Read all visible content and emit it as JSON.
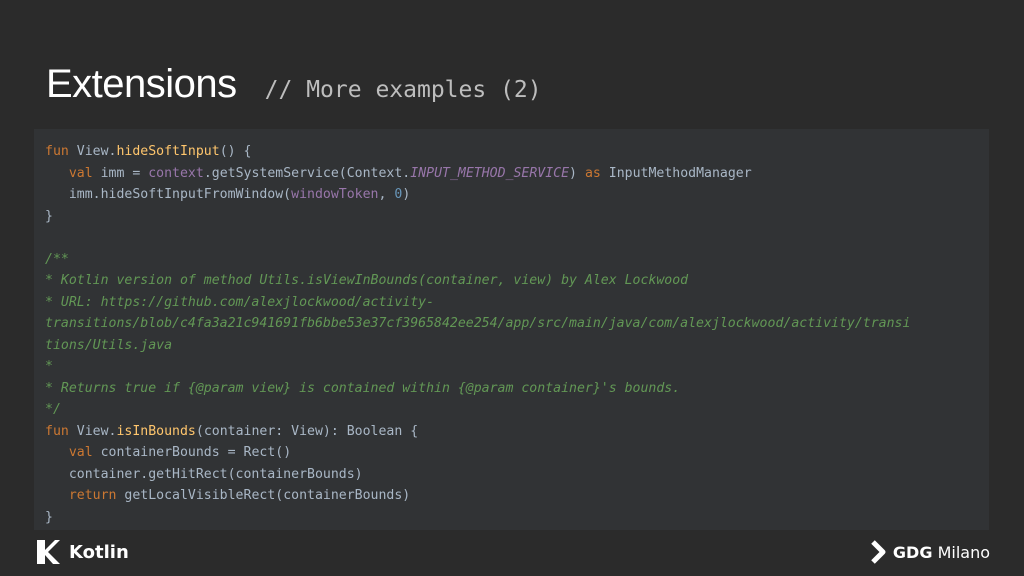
{
  "slide": {
    "title": "Extensions",
    "subtitle": "// More examples (2)"
  },
  "code_lines": [
    [
      [
        "kw",
        "fun "
      ],
      [
        "pl",
        "View."
      ],
      [
        "fn",
        "hideSoftInput"
      ],
      [
        "pl",
        "() {"
      ]
    ],
    [
      [
        "pl",
        "   "
      ],
      [
        "kw",
        "val "
      ],
      [
        "pl",
        "imm = "
      ],
      [
        "prop",
        "context"
      ],
      [
        "pl",
        ".getSystemService(Context."
      ],
      [
        "propi",
        "INPUT_METHOD_SERVICE"
      ],
      [
        "pl",
        ") "
      ],
      [
        "kw",
        "as "
      ],
      [
        "pl",
        "InputMethodManager"
      ]
    ],
    [
      [
        "pl",
        "   imm.hideSoftInputFromWindow("
      ],
      [
        "prop",
        "windowToken"
      ],
      [
        "pl",
        ", "
      ],
      [
        "num",
        "0"
      ],
      [
        "pl",
        ")"
      ]
    ],
    [
      [
        "pl",
        "}"
      ]
    ],
    [
      [
        "pl",
        ""
      ]
    ],
    [
      [
        "cm",
        "/**"
      ]
    ],
    [
      [
        "cm",
        "* Kotlin version of method Utils.isViewInBounds(container, view) by Alex Lockwood"
      ]
    ],
    [
      [
        "cm",
        "* URL: https://github.com/alexjlockwood/activity-"
      ]
    ],
    [
      [
        "cm",
        "transitions/blob/c4fa3a21c941691fb6bbe53e37cf3965842ee254/app/src/main/java/com/alexjlockwood/activity/transi"
      ]
    ],
    [
      [
        "cm",
        "tions/Utils.java"
      ]
    ],
    [
      [
        "cm",
        "*"
      ]
    ],
    [
      [
        "cm",
        "* Returns true if {@param view} is contained within {@param container}'s bounds."
      ]
    ],
    [
      [
        "cm",
        "*/"
      ]
    ],
    [
      [
        "kw",
        "fun "
      ],
      [
        "pl",
        "View."
      ],
      [
        "fn",
        "isInBounds"
      ],
      [
        "pl",
        "(container: View): Boolean {"
      ]
    ],
    [
      [
        "pl",
        "   "
      ],
      [
        "kw",
        "val "
      ],
      [
        "pl",
        "containerBounds = Rect()"
      ]
    ],
    [
      [
        "pl",
        "   container.getHitRect(containerBounds)"
      ]
    ],
    [
      [
        "pl",
        "   "
      ],
      [
        "kw",
        "return "
      ],
      [
        "pl",
        "getLocalVisibleRect(containerBounds)"
      ]
    ],
    [
      [
        "pl",
        "}"
      ]
    ]
  ],
  "footer": {
    "kotlin_label": "Kotlin",
    "gdg_strong": "GDG",
    "gdg_label": "Milano"
  },
  "colors": {
    "background": "#2b2b2b",
    "code_panel": "#313335",
    "keyword": "#cc7832",
    "function": "#ffc66d",
    "property": "#9876aa",
    "number": "#6897bb",
    "comment": "#629755",
    "plain": "#a9b7c6"
  },
  "icons": {
    "kotlin_logo": "kotlin-logo-icon",
    "gdg_logo": "gdg-chevron-icon"
  }
}
